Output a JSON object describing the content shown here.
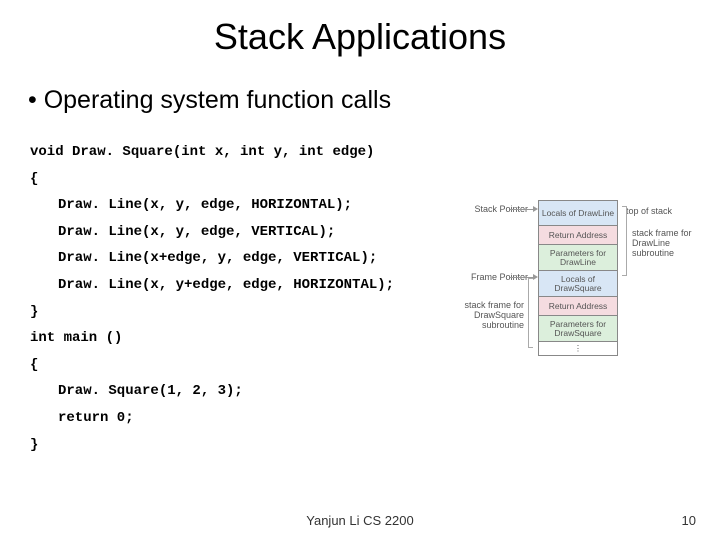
{
  "title": "Stack Applications",
  "bullet": "•  Operating system function calls",
  "code": {
    "l0": "void Draw. Square(int x, int y, int edge)",
    "l1": "{",
    "l2": "Draw. Line(x, y, edge, HORIZONTAL);",
    "l3": "Draw. Line(x, y, edge, VERTICAL);",
    "l4": "Draw. Line(x+edge, y, edge, VERTICAL);",
    "l5": "Draw. Line(x, y+edge, edge, HORIZONTAL);",
    "l6": "}",
    "l7": "int main ()",
    "l8": "{",
    "l9": "Draw. Square(1, 2, 3);",
    "l10": "return 0;",
    "l11": "}"
  },
  "diagram": {
    "top_of_stack": "top of stack",
    "stack_pointer": "Stack Pointer",
    "frame_pointer": "Frame Pointer",
    "cells": {
      "c0": "Locals of DrawLine",
      "c1": "Return Address",
      "c2": "Parameters for DrawLine",
      "c3": "Locals of DrawSquare",
      "c4": "Return Address",
      "c5": "Parameters for DrawSquare"
    },
    "right1": "stack frame for DrawLine subroutine",
    "right2": "stack frame for DrawSquare subroutine"
  },
  "footer_center": "Yanjun Li CS 2200",
  "footer_right": "10"
}
